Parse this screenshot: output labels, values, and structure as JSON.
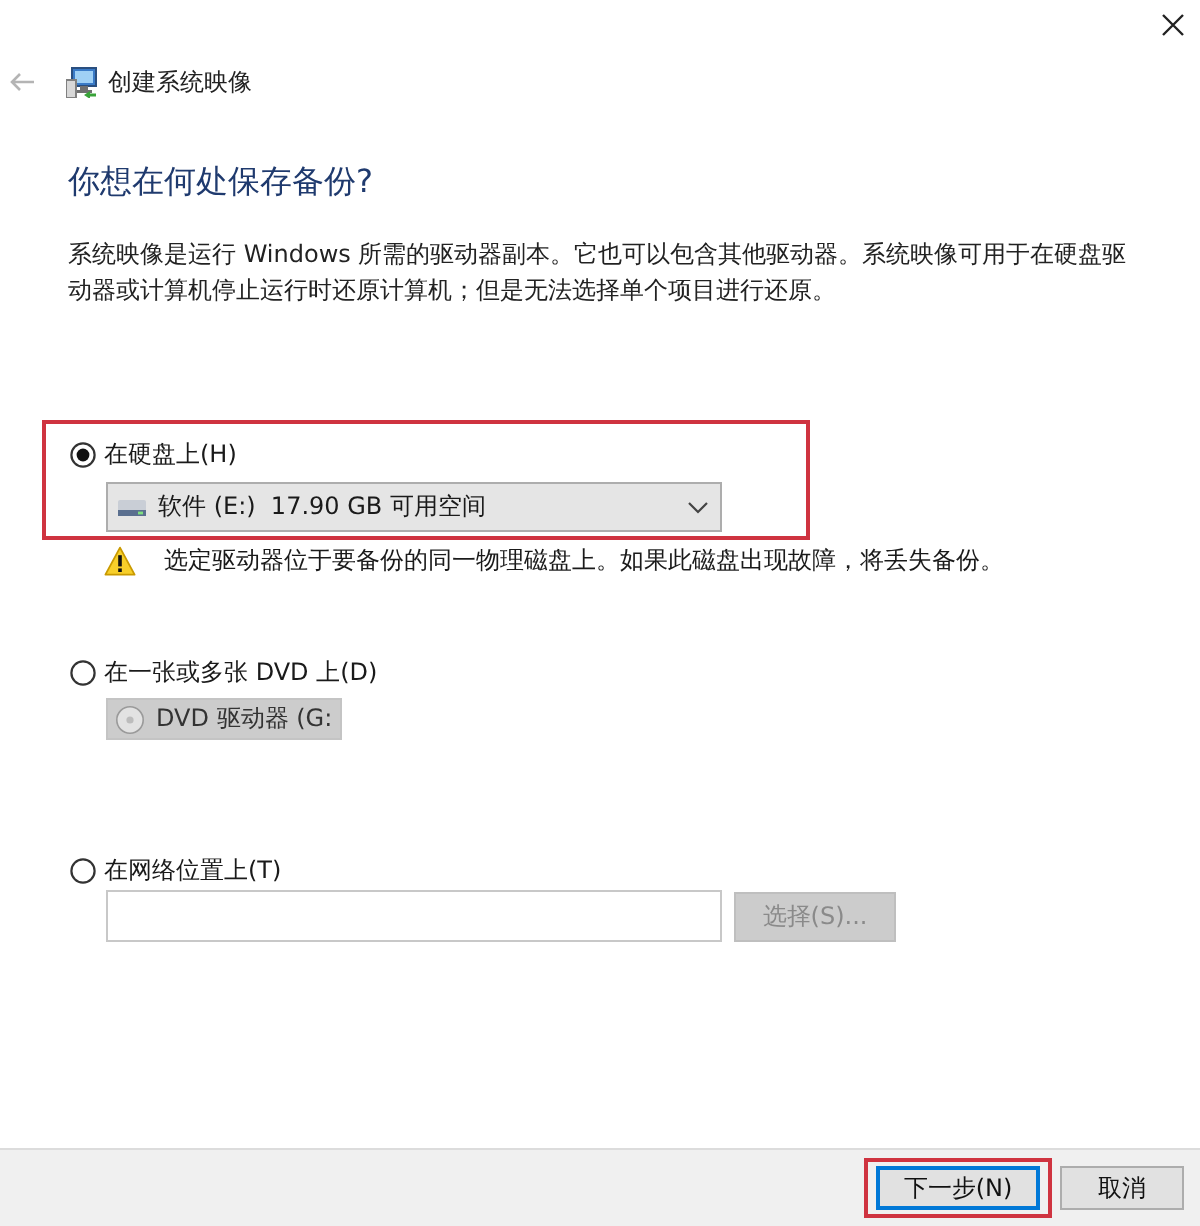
{
  "window": {
    "title": "创建系统映像"
  },
  "back_button": {
    "disabled": true
  },
  "heading": "你想在何处保存备份?",
  "description": "系统映像是运行 Windows 所需的驱动器副本。它也可以包含其他驱动器。系统映像可用于在硬盘驱动器或计算机停止运行时还原计算机；但是无法选择单个项目进行还原。",
  "options": [
    {
      "kind": "disk",
      "label": "在硬盘上(H)",
      "selected": true,
      "highlighted": true,
      "dropdown": {
        "value": "软件 (E:)  17.90 GB 可用空间",
        "disabled": false
      },
      "warning": "选定驱动器位于要备份的同一物理磁盘上。如果此磁盘出现故障，将丢失备份。"
    },
    {
      "kind": "dvd",
      "label": "在一张或多张 DVD 上(D)",
      "selected": false,
      "highlighted": false,
      "dropdown": {
        "value": "DVD 驱动器 (G:",
        "disabled": true
      }
    },
    {
      "kind": "network",
      "label": "在网络位置上(T)",
      "selected": false,
      "highlighted": false,
      "browse_button": {
        "label": "选择(S)...",
        "disabled": true
      }
    }
  ],
  "buttons": [
    {
      "label": "下一步(N)",
      "default": true,
      "highlighted": true
    },
    {
      "label": "取消",
      "default": false,
      "highlighted": false
    }
  ]
}
